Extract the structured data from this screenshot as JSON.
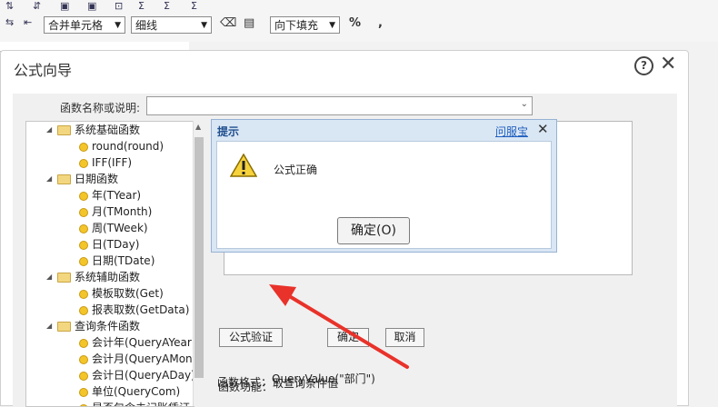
{
  "toolbar": {
    "merge_cells": "合并单元格",
    "line_style": "细线",
    "fill_down": "向下填充",
    "percent": "%",
    "comma": ","
  },
  "dialog": {
    "title": "公式向导",
    "function_search_label": "函数名称或说明:",
    "function_search_value": "",
    "verify_button": "公式验证",
    "confirm_button": "确定",
    "cancel_button": "取消",
    "function_desc_label": "函数功能：",
    "function_desc_value": "取查询条件值",
    "function_format_label": "函数格式：",
    "function_format_value": "QueryValue(\"部门\")"
  },
  "tree": {
    "groups": [
      {
        "label": "系统基础函数",
        "items": [
          "round(round)",
          "IFF(IFF)"
        ]
      },
      {
        "label": "日期函数",
        "items": [
          "年(TYear)",
          "月(TMonth)",
          "周(TWeek)",
          "日(TDay)",
          "日期(TDate)"
        ]
      },
      {
        "label": "系统辅助函数",
        "items": [
          "模板取数(Get)",
          "报表取数(GetData)"
        ]
      },
      {
        "label": "查询条件函数",
        "items": [
          "会计年(QueryAYear)",
          "会计月(QueryAMont",
          "会计日(QueryADay)",
          "单位(QueryCom)",
          "是否包含未记账凭证"
        ]
      }
    ]
  },
  "prompt": {
    "title": "提示",
    "help_link": "问服宝",
    "message": "公式正确",
    "ok_button": "确定(O)"
  }
}
